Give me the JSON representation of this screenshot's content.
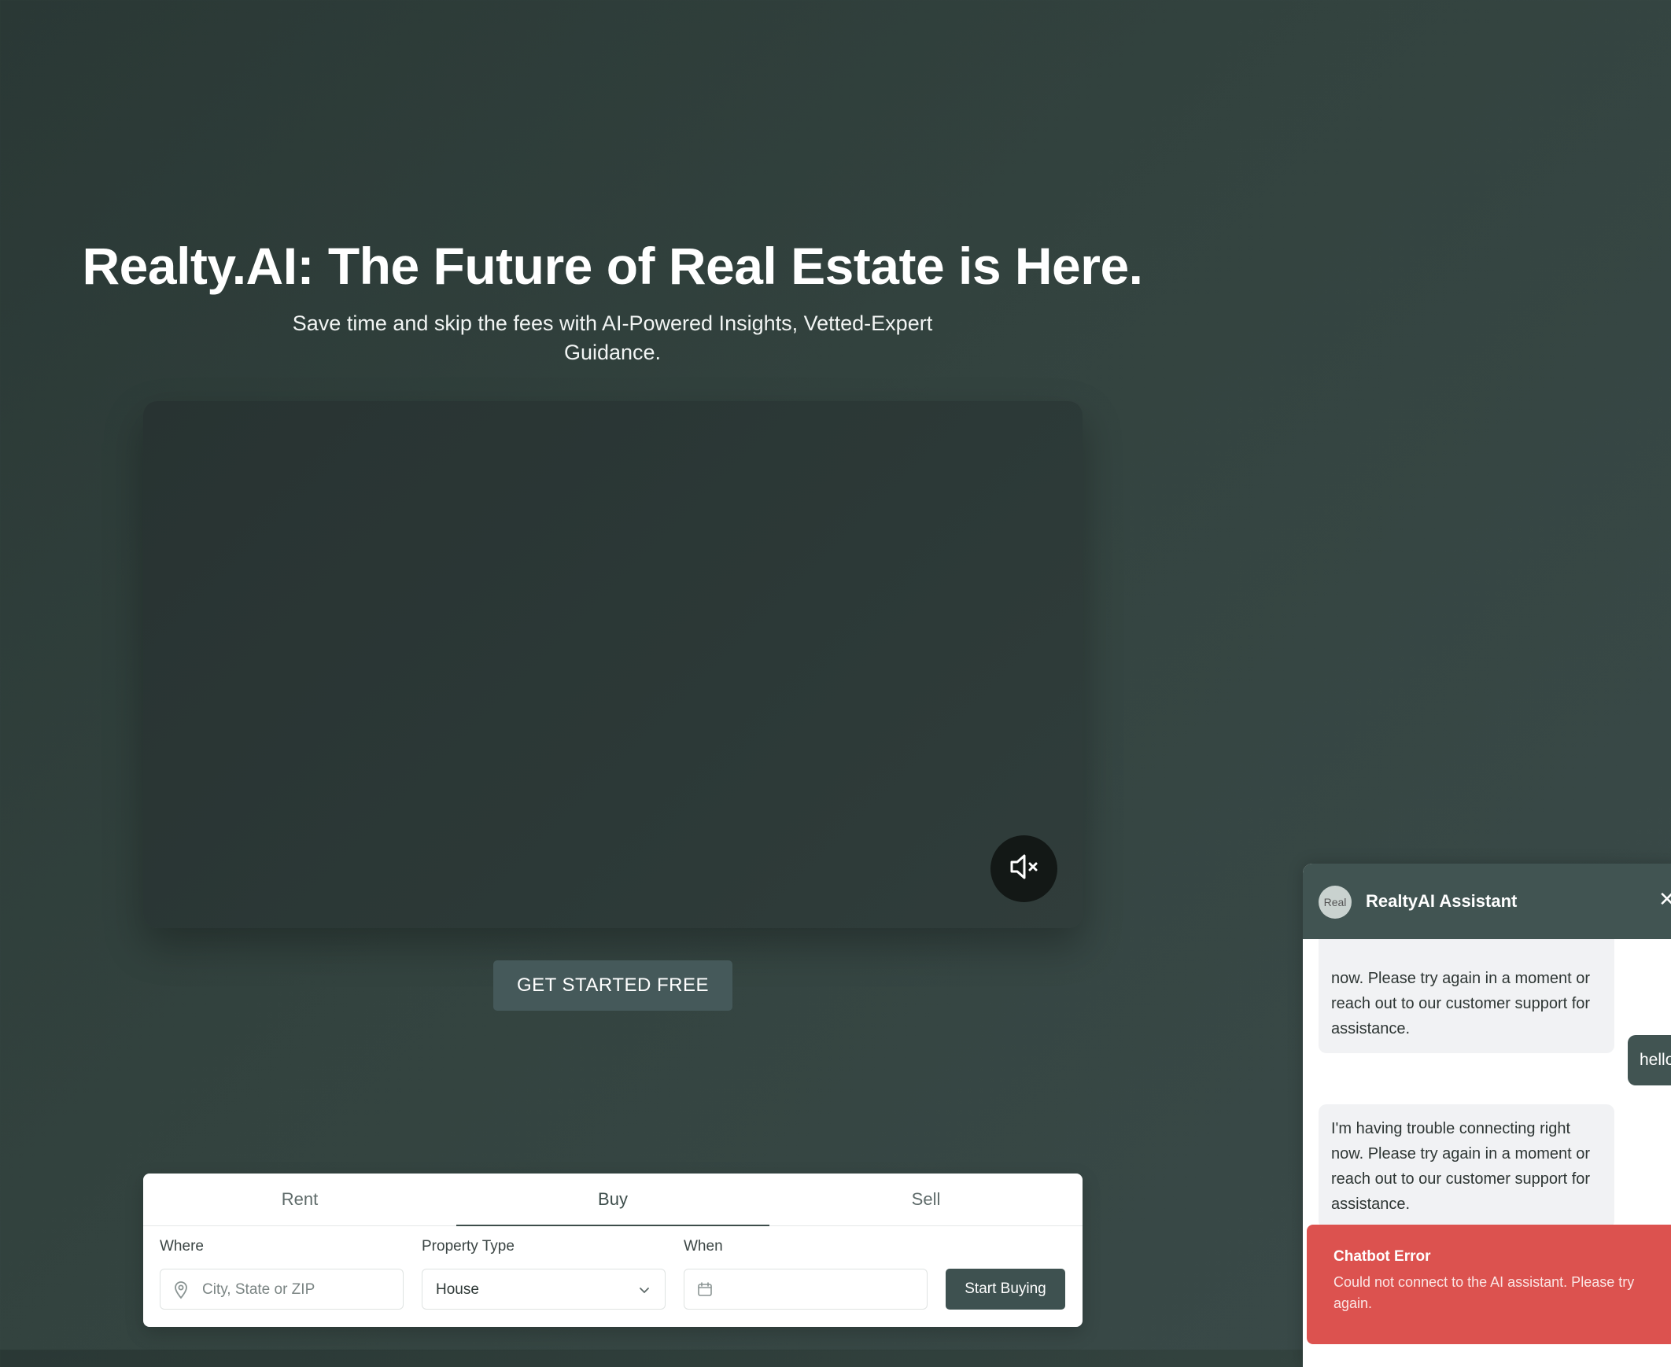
{
  "hero": {
    "title": "Realty.AI: The Future of Real Estate is Here.",
    "subtitle": "Save time and skip the fees with AI-Powered Insights, Vetted-Expert Guidance."
  },
  "video": {
    "mute_icon": "speaker-muted-icon"
  },
  "cta": {
    "label": "GET STARTED FREE"
  },
  "search": {
    "tabs": [
      {
        "label": "Rent",
        "active": false
      },
      {
        "label": "Buy",
        "active": true
      },
      {
        "label": "Sell",
        "active": false
      }
    ],
    "where": {
      "label": "Where",
      "placeholder": "City, State or ZIP",
      "icon": "location-pin-icon"
    },
    "property_type": {
      "label": "Property Type",
      "value": "House",
      "icon": "chevron-down-icon"
    },
    "when": {
      "label": "When",
      "value": "",
      "icon": "calendar-icon"
    },
    "submit_label": "Start Buying"
  },
  "chat": {
    "title": "RealtyAI Assistant",
    "avatar_alt": "Real",
    "close_icon": "close-icon",
    "messages": [
      {
        "role": "bot",
        "text": "now. Please try again in a moment or reach out to our customer support for assistance."
      },
      {
        "role": "user",
        "text": "hello"
      },
      {
        "role": "bot",
        "text": "I'm having trouble connecting right now. Please try again in a moment or reach out to our customer support for assistance."
      }
    ]
  },
  "toast": {
    "title": "Chatbot Error",
    "message": "Could not connect to the AI assistant. Please try again."
  },
  "colors": {
    "accent": "#415452",
    "error": "#dc524f"
  }
}
